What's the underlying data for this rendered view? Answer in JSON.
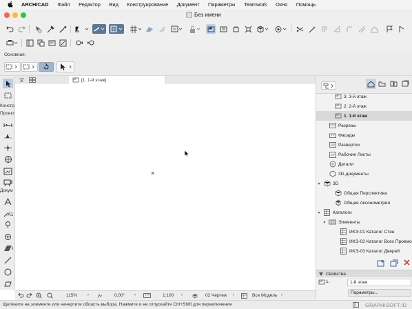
{
  "menubar": {
    "app": "ARCHICAD",
    "items": [
      "Файл",
      "Редактор",
      "Вид",
      "Конструирование",
      "Документ",
      "Параметры",
      "Teamwork",
      "Окно",
      "Помощь"
    ]
  },
  "window": {
    "title": "Без имени"
  },
  "infobox": {
    "label": "Основная:"
  },
  "toolbox": {
    "labels": [
      "Констр",
      "Проект",
      "Докум"
    ]
  },
  "tabs": [
    {
      "label": "[1. 1-й этаж]"
    }
  ],
  "canvas": {
    "cross_mark": "×"
  },
  "statusbar": {
    "zoom": "115%",
    "angle": "0,00°",
    "scale": "1:100",
    "layer_combo": "02 Чертеж",
    "model_view": "Все Модель"
  },
  "hint": "Щелкните на элементе или начертите область выбора. Нажмите и не отпускайте Ctrl+Shift для переключения",
  "branding": "GRAPHISOFT.ID",
  "navigator": {
    "items": [
      {
        "label": "3. 3-й этаж",
        "icon": "story-icon",
        "selected": false
      },
      {
        "label": "2. 2-й этаж",
        "icon": "story-icon",
        "selected": false
      },
      {
        "label": "1. 1-й этаж",
        "icon": "story-icon",
        "selected": true
      },
      {
        "label": "Разрезы",
        "icon": "section-icon",
        "selected": false
      },
      {
        "label": "Фасады",
        "icon": "elevation-icon",
        "selected": false
      },
      {
        "label": "Развертки",
        "icon": "interior-elevation-icon",
        "selected": false
      },
      {
        "label": "Рабочие Листы",
        "icon": "worksheet-icon",
        "selected": false
      },
      {
        "label": "Детали",
        "icon": "detail-icon",
        "selected": false
      },
      {
        "label": "3D-документы",
        "icon": "3d-document-icon",
        "selected": false
      },
      {
        "label": "3D",
        "icon": "3d-icon",
        "selected": false
      },
      {
        "label": "Общая Перспектива",
        "icon": "perspective-icon",
        "selected": false
      },
      {
        "label": "Общая Аксонометрия",
        "icon": "axonometry-icon",
        "selected": false
      },
      {
        "label": "Каталоги",
        "icon": "schedule-icon",
        "selected": false
      },
      {
        "label": "Элементы",
        "icon": "elements-folder-icon",
        "selected": false
      },
      {
        "label": "ИКЭ-01 Каталог Стен",
        "icon": "schedule-icon",
        "selected": false
      },
      {
        "label": "ИКЭ-02 Каталог Всех Проемов",
        "icon": "schedule-icon",
        "selected": false
      },
      {
        "label": "ИКЭ-03 Каталог Дверей",
        "icon": "schedule-icon",
        "selected": false
      }
    ]
  },
  "properties": {
    "title": "Свойства",
    "story_number": "1.",
    "story_name": "1-й этаж",
    "settings_button": "Параметры..."
  },
  "colors": {
    "accent": "#5b7895",
    "selection": "#bcd0e6",
    "close_red": "#e0352b",
    "traffic_red": "#fe5f57",
    "traffic_yellow": "#febc2e",
    "traffic_green": "#28c840"
  }
}
